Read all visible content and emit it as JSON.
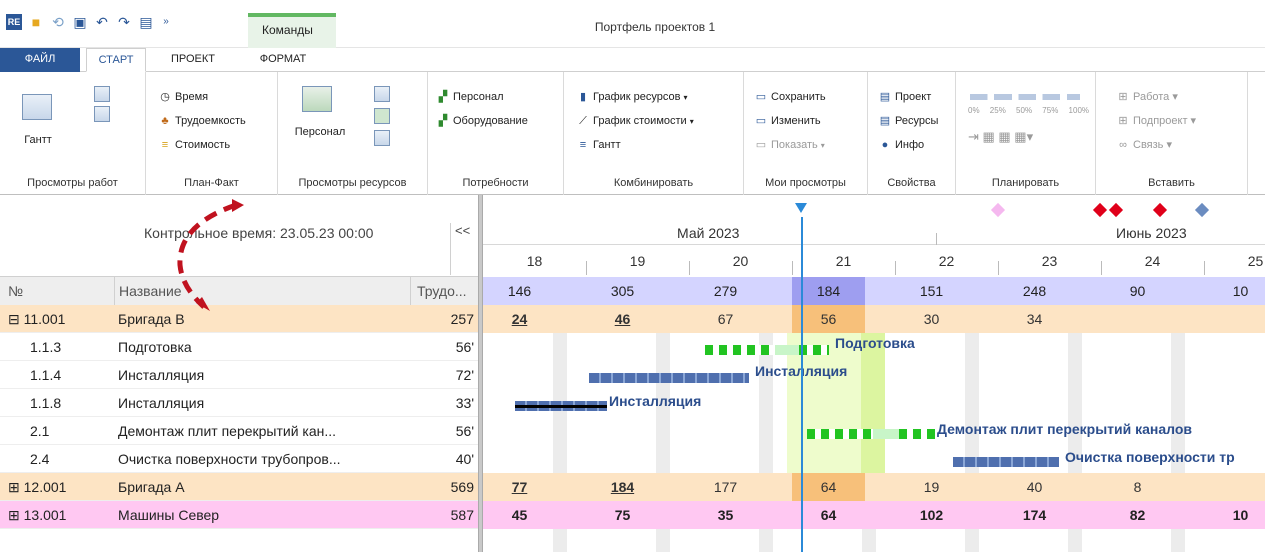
{
  "window": {
    "title": "Портфель проектов 1",
    "commands_tab": "Команды"
  },
  "tabs": [
    "ФАЙЛ",
    "СТАРТ",
    "ПРОЕКТ",
    "ФОРМАТ"
  ],
  "ribbon": {
    "gantt_big": "Гантт",
    "plan_fact": [
      "Время",
      "Трудоемкость",
      "Стоимость"
    ],
    "personnel_big": "Персонал",
    "needs": [
      "Персонал",
      "Оборудование"
    ],
    "combine": [
      "График ресурсов",
      "График стоимости",
      "Гантт"
    ],
    "my_views": [
      "Сохранить",
      "Изменить",
      "Показать"
    ],
    "props": [
      "Проект",
      "Ресурсы",
      "Инфо"
    ],
    "plan_pct": [
      "0%",
      "25%",
      "50%",
      "75%",
      "100%"
    ],
    "insert": [
      "Работа",
      "Подпроект",
      "Связь"
    ],
    "group_labels": [
      "Просмотры работ",
      "План-Факт",
      "Просмотры ресурсов",
      "Потребности",
      "Комбинировать",
      "Мои просмотры",
      "Свойства",
      "Планировать",
      "Вставить"
    ]
  },
  "left": {
    "control_time": "Контрольное время: 23.05.23 00:00",
    "collapse": "<<",
    "headers": {
      "num": "№",
      "name": "Название",
      "work": "Трудо..."
    },
    "rows": [
      {
        "num": "⊟ 11.001",
        "name": "Бригада B",
        "work": "257"
      },
      {
        "num": "1.1.3",
        "name": "Подготовка",
        "work": "56'"
      },
      {
        "num": "1.1.4",
        "name": "Инсталляция",
        "work": "72'"
      },
      {
        "num": "1.1.8",
        "name": "Инсталляция",
        "work": "33'"
      },
      {
        "num": "2.1",
        "name": "Демонтаж  плит перекрытий кан...",
        "work": "56'"
      },
      {
        "num": "2.4",
        "name": "Очистка поверхности трубопров...",
        "work": "40'"
      },
      {
        "num": "⊞ 12.001",
        "name": "Бригада А",
        "work": "569"
      },
      {
        "num": "⊞ 13.001",
        "name": "Машины Север",
        "work": "587"
      }
    ]
  },
  "gantt": {
    "month1": "Май 2023",
    "month2": "Июнь 2023",
    "days": [
      "18",
      "19",
      "20",
      "21",
      "22",
      "23",
      "24",
      "25"
    ],
    "totals": [
      "146",
      "305",
      "279",
      "184",
      "151",
      "248",
      "90",
      "10"
    ],
    "brigade_b": [
      "24",
      "46",
      "67",
      "56",
      "30",
      "34",
      "",
      ""
    ],
    "brigade_a": [
      "77",
      "184",
      "177",
      "64",
      "19",
      "40",
      "8",
      ""
    ],
    "machines": [
      "45",
      "75",
      "35",
      "64",
      "102",
      "174",
      "82",
      "10"
    ],
    "bar_labels": [
      "Подготовка",
      "Инсталляция",
      "Инсталляция",
      "Демонтаж  плит перекрытий каналов",
      "Очистка поверхности тр"
    ]
  },
  "colors": {
    "accent": "#2b5797",
    "bar": "#5b7bb5",
    "green": "#22c422",
    "orange_row": "#fde4c4",
    "pink_row": "#ffc8f2",
    "arrow": "#c0121f"
  }
}
